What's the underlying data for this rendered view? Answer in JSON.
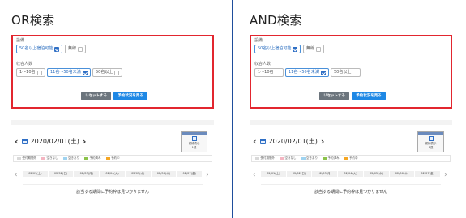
{
  "panels": [
    {
      "heading": "OR検索",
      "facility_label": "設備",
      "facility_options": [
        {
          "label": "50名以上宿泊可能",
          "checked": true
        },
        {
          "label": "無線",
          "checked": false
        }
      ],
      "capacity_label": "収容人数",
      "capacity_options": [
        {
          "label": "1〜10名",
          "checked": false
        },
        {
          "label": "11名〜50名未満",
          "checked": true
        },
        {
          "label": "50名以上",
          "checked": false
        }
      ],
      "reset_label": "リセットする",
      "search_label": "予約状況を見る",
      "date_label": "2020/02/01(土)",
      "widget": {
        "tag": "Today",
        "caption": "候補表示",
        "select": "1週"
      },
      "legend": [
        {
          "label": "受付期間外",
          "color": "#d9d9d9"
        },
        {
          "label": "空きなし",
          "color": "#f4b6c2"
        },
        {
          "label": "空きあり",
          "color": "#9fd3f0"
        },
        {
          "label": "予約済み",
          "color": "#8bc34a"
        },
        {
          "label": "予約中",
          "color": "#f5a623"
        }
      ],
      "days": [
        "02/01(土)",
        "02/02(日)",
        "02/03(月)",
        "02/04(火)",
        "02/05(水)",
        "02/06(木)",
        "02/07(金)"
      ],
      "empty_message": "該当する期間に予約枠は見つかりません"
    },
    {
      "heading": "AND検索",
      "facility_label": "設備",
      "facility_options": [
        {
          "label": "50名以上宿泊可能",
          "checked": true
        },
        {
          "label": "無線",
          "checked": false
        }
      ],
      "capacity_label": "収容人数",
      "capacity_options": [
        {
          "label": "1〜10名",
          "checked": false
        },
        {
          "label": "11名〜50名未満",
          "checked": true
        },
        {
          "label": "50名以上",
          "checked": false
        }
      ],
      "reset_label": "リセットする",
      "search_label": "予約状況を見る",
      "date_label": "2020/02/01(土)",
      "widget": {
        "tag": "Today",
        "caption": "候補表示",
        "select": "1週"
      },
      "legend": [
        {
          "label": "受付期間外",
          "color": "#d9d9d9"
        },
        {
          "label": "空きなし",
          "color": "#f4b6c2"
        },
        {
          "label": "空きあり",
          "color": "#9fd3f0"
        },
        {
          "label": "予約済み",
          "color": "#8bc34a"
        },
        {
          "label": "予約中",
          "color": "#f5a623"
        }
      ],
      "days": [
        "02/01(土)",
        "02/02(日)",
        "02/03(月)",
        "02/04(火)",
        "02/05(水)",
        "02/06(木)",
        "02/07(金)"
      ],
      "empty_message": "該当する期間に予約枠は見つかりません"
    }
  ],
  "colors": {
    "highlight_border": "#e2262f",
    "accent": "#1e88e5",
    "divider": "#1f4e9c"
  }
}
